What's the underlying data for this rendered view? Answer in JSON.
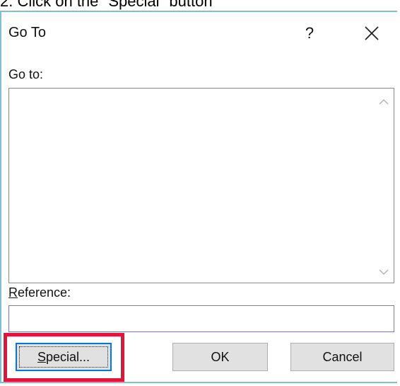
{
  "caption": "2. Click on the \"Special\" button",
  "dialog": {
    "title": "Go To",
    "help_label": "?",
    "goto_label": "Go to:",
    "goto_items": [],
    "reference": {
      "label_accel": "R",
      "label_rest": "eference:",
      "value": ""
    },
    "buttons": {
      "special_accel": "S",
      "special_rest": "pecial...",
      "ok": "OK",
      "cancel": "Cancel"
    }
  },
  "colors": {
    "highlight": "#e5133a",
    "focus": "#0078d7",
    "dialog_border": "#7fbfd4"
  },
  "icons": {
    "close": "close-icon",
    "scroll_up": "chevron-up-icon",
    "scroll_down": "chevron-down-icon"
  }
}
